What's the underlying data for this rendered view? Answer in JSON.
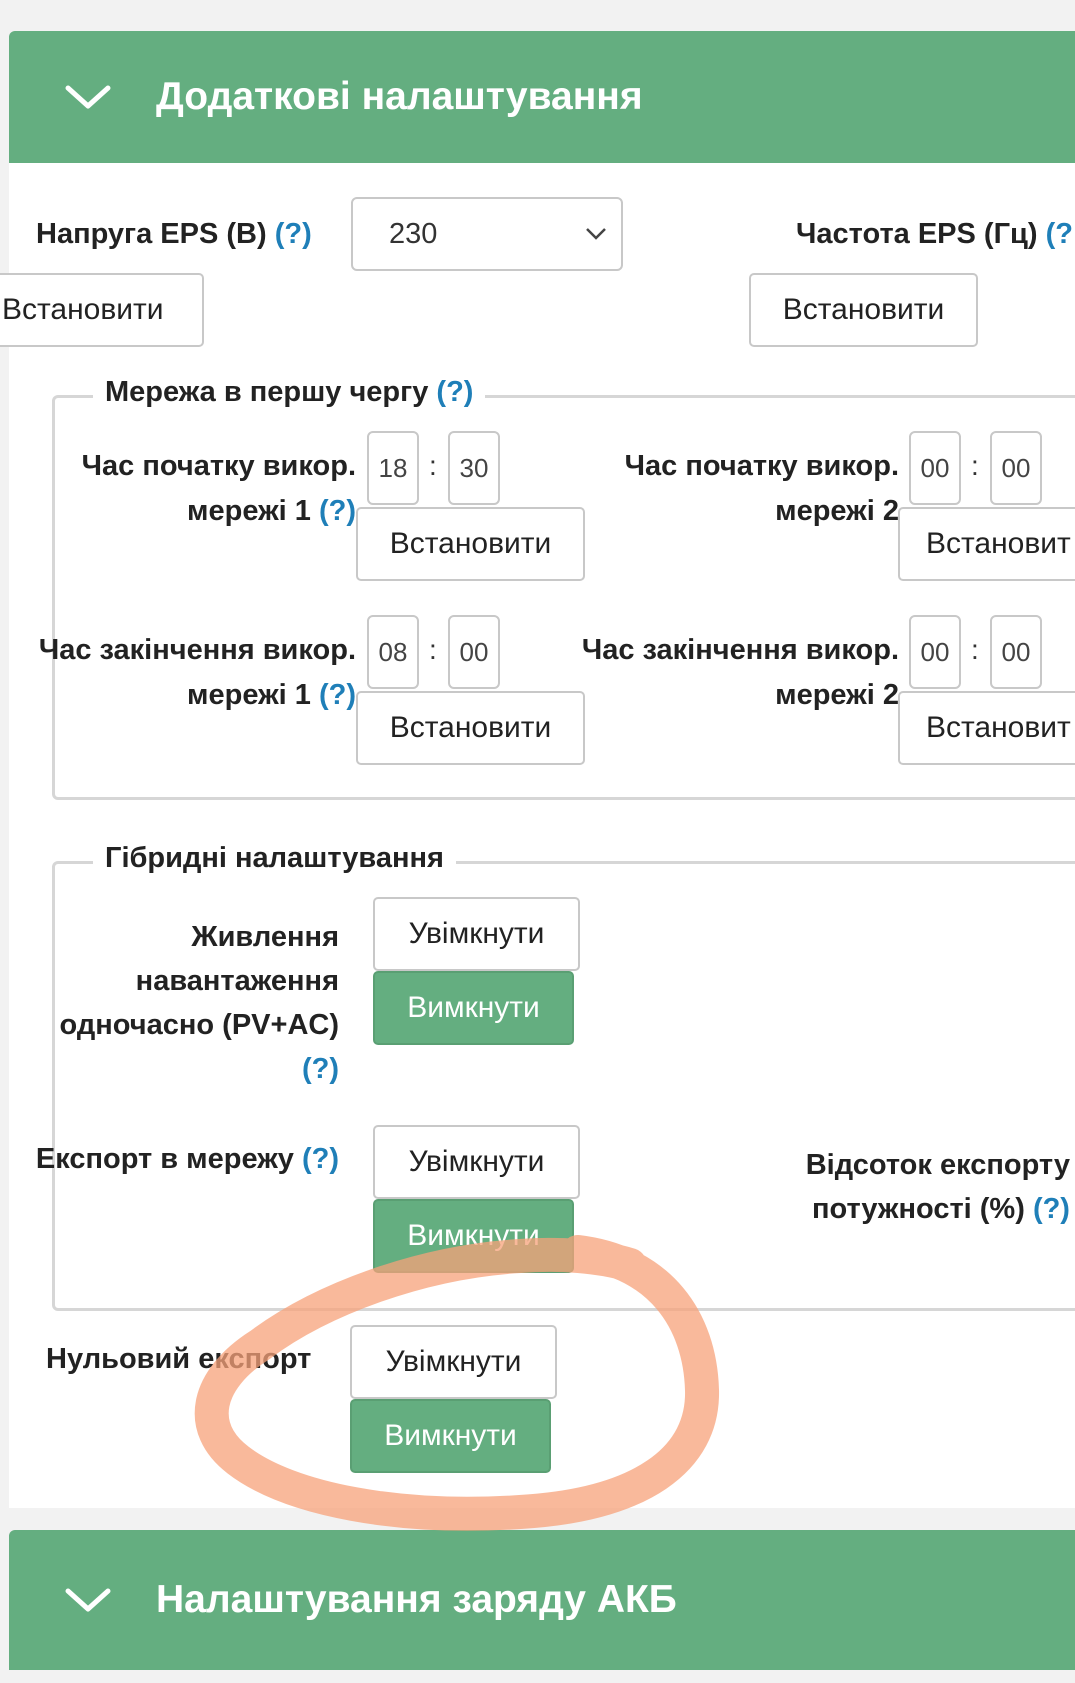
{
  "panel1": {
    "title": "Додаткові налаштування"
  },
  "eps": {
    "voltage_label": "Напруга EPS (В)",
    "voltage_help": "(?)",
    "voltage_value": "230",
    "set_button_1": "Встановити",
    "frequency_label": "Частота EPS (Гц)",
    "frequency_help": "(?",
    "set_button_2": "Встановити"
  },
  "grid_priority": {
    "legend": "Мережа в першу чергу",
    "legend_help": "(?)",
    "start1": {
      "label_l1": "Час початку викор.",
      "label_l2": "мережі 1",
      "help": "(?)",
      "hh": "18",
      "mm": "30",
      "button": "Встановити"
    },
    "start2": {
      "label_l1": "Час початку викор.",
      "label_l2": "мережі 2",
      "hh": "00",
      "mm": "00",
      "button": "Встановит"
    },
    "end1": {
      "label_l1": "Час закінчення викор.",
      "label_l2": "мережі 1",
      "help": "(?)",
      "hh": "08",
      "mm": "00",
      "button": "Встановити"
    },
    "end2": {
      "label_l1": "Час закінчення викор.",
      "label_l2": "мережі 2",
      "hh": "00",
      "mm": "00",
      "button": "Встановит"
    },
    "colon": ":"
  },
  "hybrid": {
    "legend": "Гібридні налаштування",
    "load_label_l1": "Живлення",
    "load_label_l2": "навантаження",
    "load_label_l3": "одночасно (PV+AC)",
    "load_help": "(?)",
    "export_label": "Експорт в мережу",
    "export_help": "(?)",
    "export_pct_l1": "Відсоток експорту",
    "export_pct_l2": "потужності (%)",
    "export_pct_help": "(?)",
    "on": "Увімкнути",
    "off": "Вимкнути"
  },
  "zero_export": {
    "label": "Нульовий експорт",
    "on": "Увімкнути",
    "off": "Вимкнути"
  },
  "panel2": {
    "title": "Налаштування заряду АКБ"
  },
  "colors": {
    "accent_green": "#64ae80",
    "help_blue": "#1f7fb8",
    "annotation_orange": "#f7a27a"
  }
}
